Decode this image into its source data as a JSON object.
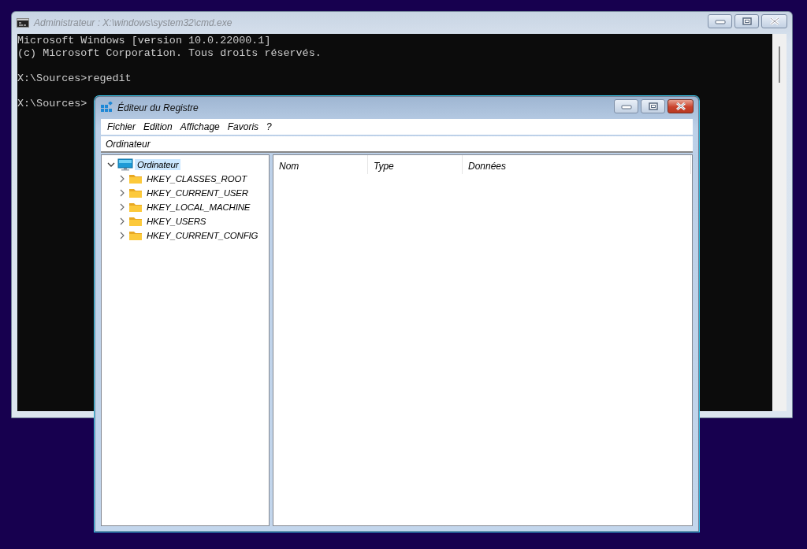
{
  "console_window": {
    "title": "Administrateur : X:\\windows\\system32\\cmd.exe",
    "active": false,
    "lines": [
      {
        "text": "Microsoft Windows [version 10.0.22000.1]",
        "blank_before": false
      },
      {
        "text": "(c) Microsoft Corporation. Tous droits réservés.",
        "blank_before": false
      },
      {
        "text": "X:\\Sources>regedit",
        "blank_before": true
      },
      {
        "text": "X:\\Sources>",
        "blank_before": true
      }
    ]
  },
  "registry_window": {
    "title": "Éditeur du Registre",
    "active": true,
    "menu": [
      "Fichier",
      "Edition",
      "Affichage",
      "Favoris",
      "?"
    ],
    "address": "Ordinateur",
    "tree": [
      {
        "label": "Ordinateur",
        "kind": "computer",
        "expanded": true,
        "selected": true,
        "children": [
          {
            "label": "HKEY_CLASSES_ROOT",
            "kind": "folder",
            "expanded": false,
            "selected": false
          },
          {
            "label": "HKEY_CURRENT_USER",
            "kind": "folder",
            "expanded": false,
            "selected": false
          },
          {
            "label": "HKEY_LOCAL_MACHINE",
            "kind": "folder",
            "expanded": false,
            "selected": false
          },
          {
            "label": "HKEY_USERS",
            "kind": "folder",
            "expanded": false,
            "selected": false
          },
          {
            "label": "HKEY_CURRENT_CONFIG",
            "kind": "folder",
            "expanded": false,
            "selected": false
          }
        ]
      }
    ],
    "columns": [
      "Nom",
      "Type",
      "Données"
    ]
  }
}
